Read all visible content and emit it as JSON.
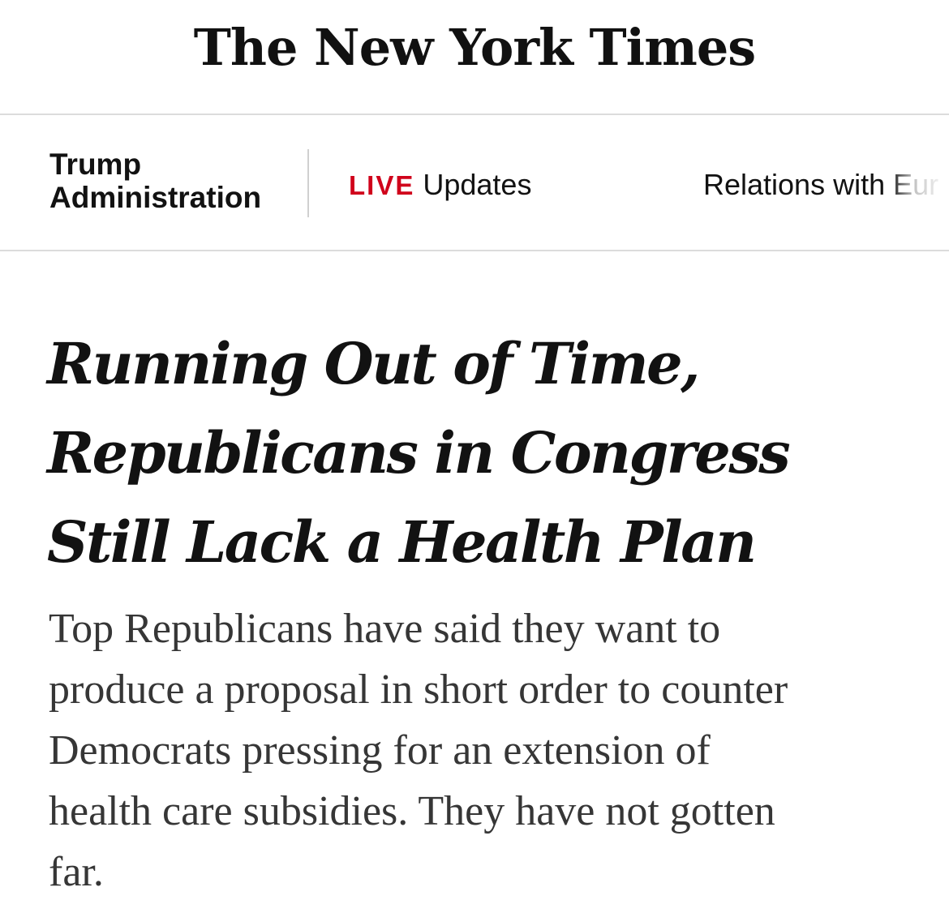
{
  "masthead": {
    "logo_text": "The New York Times"
  },
  "subnav": {
    "section_label_lines": [
      "Trump",
      "Administration"
    ],
    "live_badge": "LIVE",
    "live_link_label": "Updates",
    "relations_link_label": "Relations with Eur",
    "colors": {
      "live_badge": "#d0021b",
      "divider": "#d0d0d0"
    }
  },
  "article": {
    "headline_lines": [
      "Running Out of Time,",
      "Republicans in Congress",
      "Still Lack a Health Plan"
    ],
    "summary_lines": [
      "Top Republicans have said they want to",
      "produce a proposal in short order to counter",
      "Democrats pressing for an extension of",
      "health care subsidies. They have not gotten",
      "far."
    ]
  }
}
